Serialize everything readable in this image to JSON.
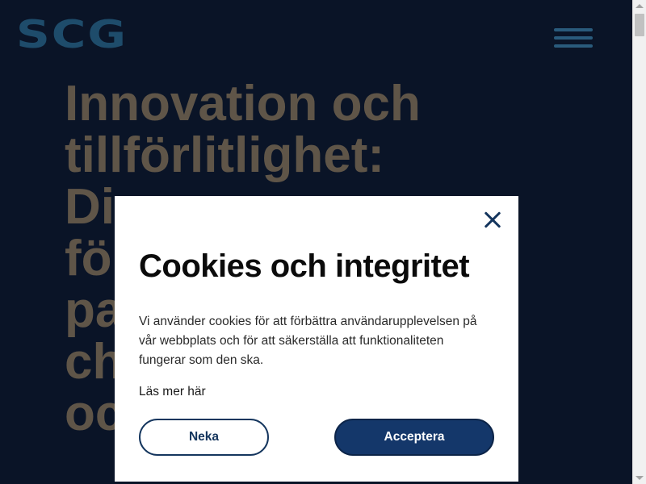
{
  "header": {
    "logo_text": "SCG",
    "menu_icon": "hamburger-menu-icon"
  },
  "hero": {
    "heading": "Innovation och tillförlitlighet: Di… fö… pa… ch… oc…"
  },
  "cookie_dialog": {
    "close_icon": "close-icon",
    "title": "Cookies och integritet",
    "body": "Vi använder cookies för att förbättra användarupplevelsen på vår webbplats och för att säkerställa att funktionaliteten fungerar som den ska.",
    "read_more": "Läs mer här",
    "decline_label": "Neka",
    "accept_label": "Acceptera"
  },
  "colors": {
    "page_background": "#0a1427",
    "logo": "#1e4c6b",
    "hero_text": "#5f5548",
    "accent": "#14376a"
  }
}
